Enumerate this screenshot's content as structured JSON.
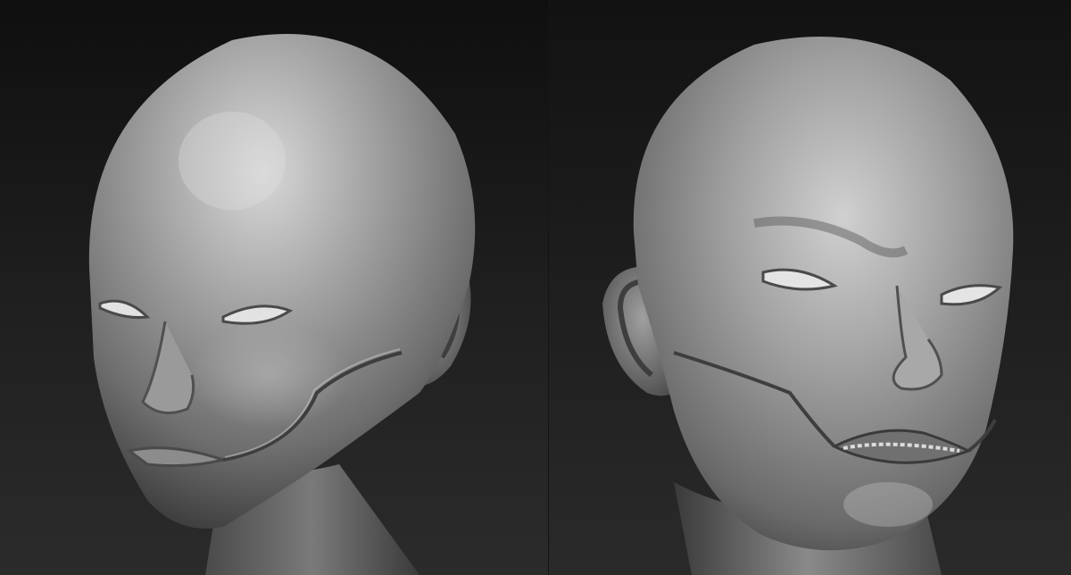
{
  "image": {
    "type": "3d-sculpt-render",
    "panels": [
      {
        "view": "three-quarter-left",
        "expression": "neutral"
      },
      {
        "view": "three-quarter-right",
        "expression": "grimace-teeth"
      }
    ],
    "colors": {
      "background_top": "#0f0f0f",
      "background_bottom": "#2b2b2b",
      "clay_highlight": "#d6d6d6",
      "clay_mid": "#8a8a8a",
      "clay_shadow": "#3a3a3a"
    }
  }
}
